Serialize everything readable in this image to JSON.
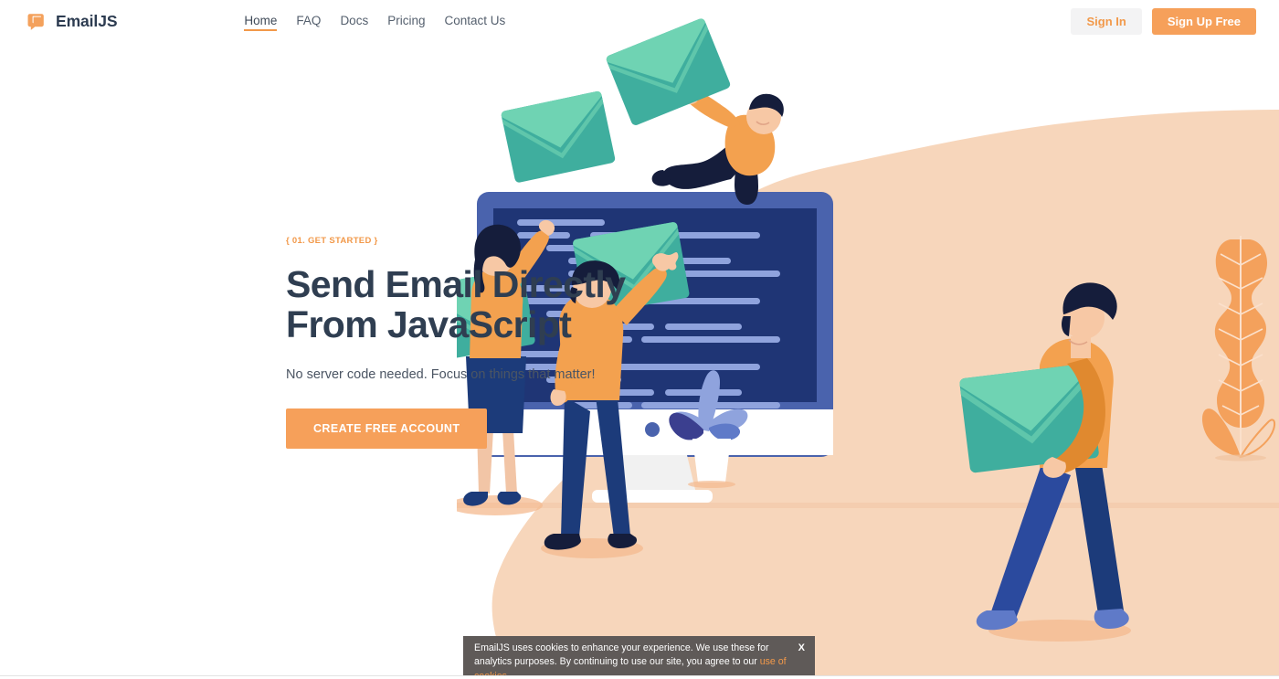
{
  "brand": {
    "name": "EmailJS",
    "logo_icon": "emailjs-cursor-logo"
  },
  "nav": {
    "items": [
      {
        "label": "Home",
        "active": true
      },
      {
        "label": "FAQ",
        "active": false
      },
      {
        "label": "Docs",
        "active": false
      },
      {
        "label": "Pricing",
        "active": false
      },
      {
        "label": "Contact Us",
        "active": false
      }
    ]
  },
  "header_actions": {
    "sign_in": "Sign In",
    "sign_up": "Sign Up Free"
  },
  "hero": {
    "eyebrow": "{ 01. GET STARTED }",
    "title": "Send Email Directly\nFrom JavaScript",
    "subtitle": "No server code needed. Focus on things that matter!",
    "cta": "CREATE FREE ACCOUNT"
  },
  "illustration": {
    "alt": "People carrying large envelopes around a computer monitor showing code"
  },
  "cookie_banner": {
    "text": "EmailJS uses cookies to enhance your experience. We use these for analytics purposes. By continuing to use our site, you agree to our ",
    "link_label": "use of cookies",
    "close_label": "X"
  },
  "colors": {
    "accent_orange": "#f6a05a",
    "accent_orange_text": "#f2994a",
    "heading_navy": "#2f3e51",
    "blob_peach": "#f7d6bb",
    "envelope_teal": "#5ccfb0",
    "monitor_navy": "#1f3575",
    "monitor_frame": "#4a63ad",
    "cookie_bg": "#5f5a58"
  }
}
